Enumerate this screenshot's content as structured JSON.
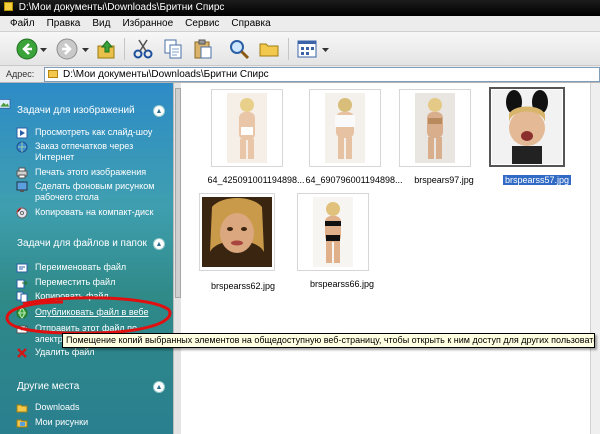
{
  "window": {
    "title": "D:\\Мои документы\\Downloads\\Бритни Спирс"
  },
  "menu": {
    "items": [
      "Файл",
      "Правка",
      "Вид",
      "Избранное",
      "Сервис",
      "Справка"
    ]
  },
  "toolbar": {
    "buttons": [
      "back-icon",
      "forward-icon",
      "up-folder-icon",
      "cut-icon",
      "copy-icon",
      "paste-icon",
      "search-icon",
      "folders-icon",
      "views-icon"
    ]
  },
  "address": {
    "label": "Адрес:",
    "value": "D:\\Мои документы\\Downloads\\Бритни Спирс"
  },
  "taskpane": {
    "image_tasks": {
      "title": "Задачи для изображений",
      "items": [
        {
          "icon": "slideshow-icon",
          "label": "Просмотреть как слайд-шоу"
        },
        {
          "icon": "order-prints-icon",
          "label": "Заказ отпечатков через Интернет"
        },
        {
          "icon": "print-icon",
          "label": "Печать этого изображения"
        },
        {
          "icon": "desktop-background-icon",
          "label": "Сделать фоновым рисунком рабочего стола"
        },
        {
          "icon": "cd-copy-icon",
          "label": "Копировать на компакт-диск"
        }
      ]
    },
    "file_tasks": {
      "title": "Задачи для файлов и папок",
      "items": [
        {
          "icon": "rename-icon",
          "label": "Переименовать файл"
        },
        {
          "icon": "move-icon",
          "label": "Переместить файл"
        },
        {
          "icon": "copy-file-icon",
          "label": "Копировать файл"
        },
        {
          "icon": "publish-web-icon",
          "label": "Опубликовать файл в вебе"
        },
        {
          "icon": "email-icon",
          "label": "Отправить этот файл по электронной почте"
        },
        {
          "icon": "delete-icon",
          "label": "Удалить файл"
        }
      ]
    },
    "other_places": {
      "title": "Другие места",
      "items": [
        {
          "icon": "folder-icon",
          "label": "Downloads"
        },
        {
          "icon": "folder-icon",
          "label": "Мои рисунки"
        }
      ]
    }
  },
  "files": [
    {
      "name": "64_425091001194898...",
      "selected": false
    },
    {
      "name": "64_690796001194898...",
      "selected": false
    },
    {
      "name": "brspears97.jpg",
      "selected": false
    },
    {
      "name": "brspearss57.jpg",
      "selected": true
    },
    {
      "name": "brspearss62.jpg",
      "selected": false
    },
    {
      "name": "brspearss66.jpg",
      "selected": false
    }
  ],
  "tooltip": {
    "text": "Помещение копий выбранных элементов на общедоступную веб-страницу, чтобы открыть к ним доступ для других пользователей."
  },
  "colors": {
    "taskpane_top": "#2e8bc7",
    "taskpane_bottom": "#2a7f8f",
    "selection": "#316ac5",
    "annotation": "#e01010",
    "tooltip_bg": "#ffffe1"
  }
}
